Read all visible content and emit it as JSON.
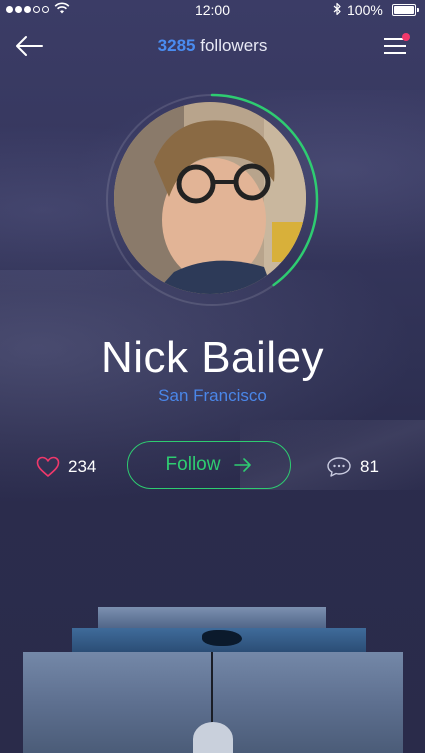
{
  "status_bar": {
    "time": "12:00",
    "battery": "100%",
    "battery_level": 1.0,
    "signal_bars_filled": 3,
    "signal_bars_total": 5
  },
  "header": {
    "followers_count": "3285",
    "followers_label": "followers"
  },
  "profile": {
    "name": "Nick Bailey",
    "location": "San Francisco",
    "ring_progress": 0.4
  },
  "actions": {
    "likes": "234",
    "follow_label": "Follow",
    "comments": "81"
  },
  "colors": {
    "accent_green": "#2ecc71",
    "accent_blue": "#4a86e8",
    "heart_pink": "#f0386b",
    "notification": "#f0386b"
  },
  "icons": {
    "back": "back-arrow-icon",
    "menu": "menu-icon",
    "like": "heart-icon",
    "follow_arrow": "arrow-right-icon",
    "comment": "comment-icon"
  }
}
